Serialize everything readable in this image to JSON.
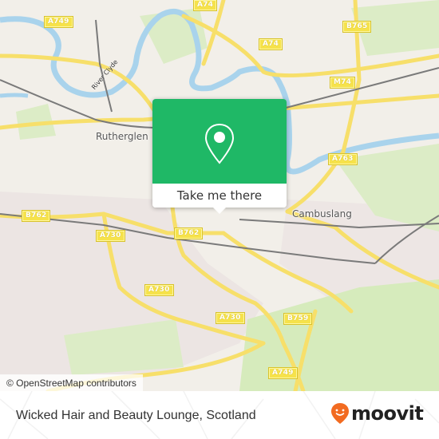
{
  "map": {
    "place_labels": [
      {
        "name": "Rutherglen"
      },
      {
        "name": "Cambuslang"
      }
    ],
    "river_label": "River Clyde",
    "road_labels": [
      "A749",
      "A74",
      "B765",
      "M74",
      "A763",
      "B762",
      "A730",
      "B762",
      "A730",
      "A730",
      "B759",
      "A749"
    ],
    "attribution": "© OpenStreetMap contributors",
    "colors": {
      "land": "#f2efe9",
      "park": "#cfe8b4",
      "water": "#a9d3ec",
      "road": "#f7df6a",
      "rail": "#707070"
    }
  },
  "popup": {
    "button_label": "Take me there",
    "pin_icon": "map-pin-icon",
    "accent_color": "#1fb866"
  },
  "footer": {
    "title": "Wicked Hair and Beauty Lounge, Scotland",
    "brand": "moovit",
    "brand_color": "#f26b21"
  }
}
